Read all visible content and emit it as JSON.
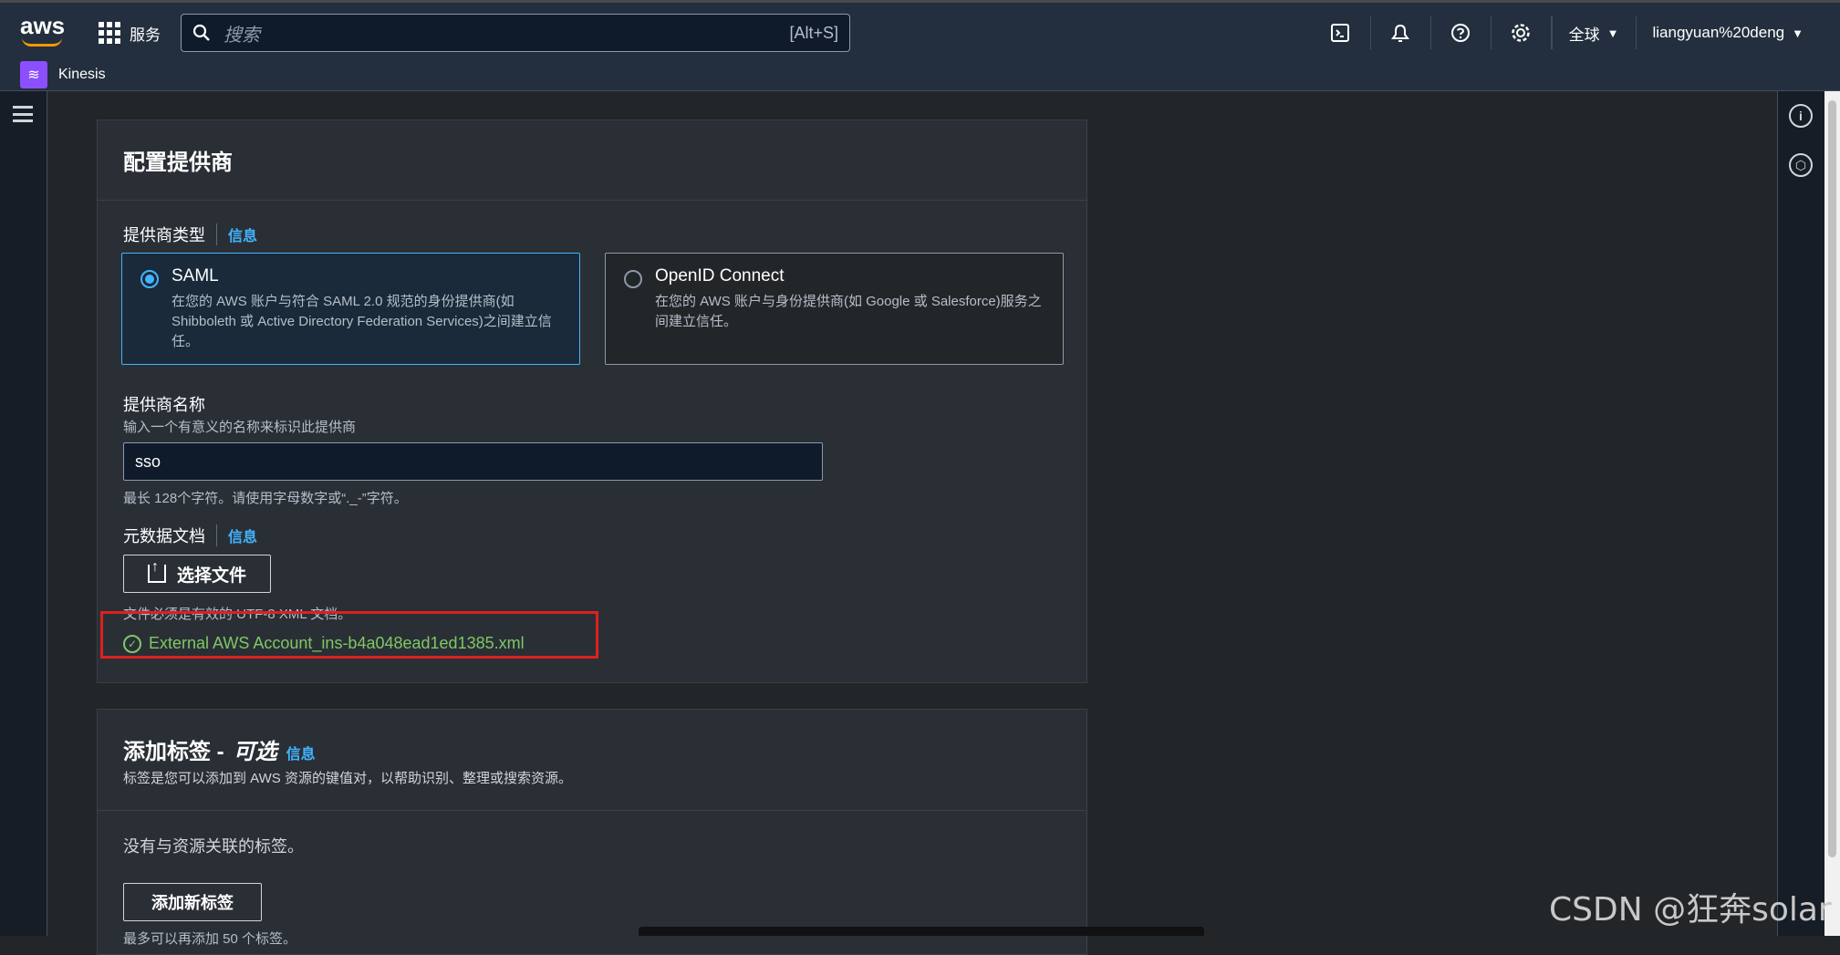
{
  "topbar": {
    "logo": "aws",
    "services_label": "服务",
    "search_placeholder": "搜索",
    "search_shortcut": "[Alt+S]",
    "region_label": "全球",
    "account_label": "liangyuan%20deng"
  },
  "service": {
    "name": "Kinesis"
  },
  "configure_provider": {
    "title": "配置提供商",
    "provider_type_label": "提供商类型",
    "info_label": "信息",
    "options": [
      {
        "title": "SAML",
        "description": "在您的 AWS 账户与符合 SAML 2.0 规范的身份提供商(如 Shibboleth 或 Active Directory Federation Services)之间建立信任。",
        "selected": true
      },
      {
        "title": "OpenID Connect",
        "description": "在您的 AWS 账户与身份提供商(如 Google 或 Salesforce)服务之间建立信任。",
        "selected": false
      }
    ],
    "name_label": "提供商名称",
    "name_description": "输入一个有意义的名称来标识此提供商",
    "name_value": "sso",
    "name_constraint": "最长 128个字符。请使用字母数字或“._-”字符。",
    "metadata_label": "元数据文档",
    "metadata_info": "信息",
    "choose_file_label": "选择文件",
    "file_note": "文件必须是有效的 UTF-8 XML 文档。",
    "uploaded_file": "External AWS Account_ins-b4a048ead1ed1385.xml"
  },
  "tags": {
    "title": "添加标签 -",
    "optional": "可选",
    "info_label": "信息",
    "description": "标签是您可以添加到 AWS 资源的键值对，以帮助识别、整理或搜索资源。",
    "empty_text": "没有与资源关联的标签。",
    "add_button": "添加新标签",
    "limit_note": "最多可以再添加 50 个标签。"
  },
  "watermark": "CSDN @狂奔solar"
}
